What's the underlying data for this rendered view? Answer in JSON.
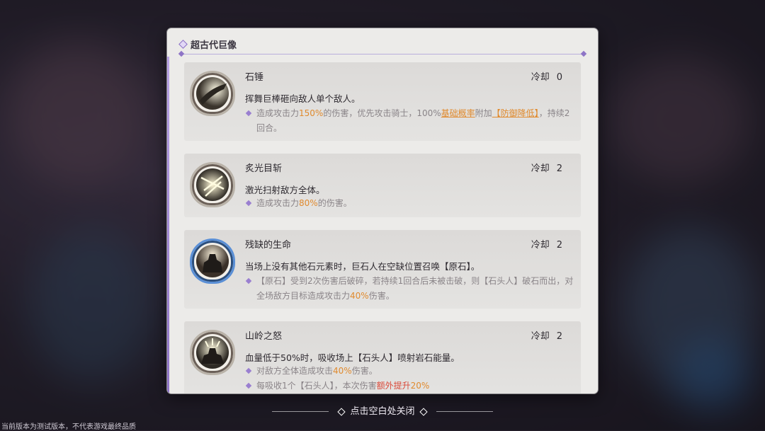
{
  "panel": {
    "title": "超古代巨像"
  },
  "cooldown_label": "冷却",
  "skills": [
    {
      "name": "石锤",
      "cooldown": "0",
      "desc": "挥舞巨棒砸向敌人单个敌人。",
      "effect": {
        "p1": "造成攻击力",
        "v1": "150%",
        "p2": "的伤害，优先攻击骑士，100%",
        "v2": "基础概率",
        "p3": "附加",
        "v3": "【防御降低】",
        "p4": "，持续2回合。"
      }
    },
    {
      "name": "炙光目斩",
      "cooldown": "2",
      "desc": "激光扫射敌方全体。",
      "effect": {
        "p1": "造成攻击力",
        "v1": "80%",
        "p2": "的伤害。"
      }
    },
    {
      "name": "残缺的生命",
      "cooldown": "2",
      "desc": "当场上没有其他石元素时，巨石人在空缺位置召唤【原石】。",
      "effect": {
        "p1": "【原石】受到2次伤害后破碎，若持续1回合后未被击破，则【石头人】破石而出，对全场敌方目标造成攻击力",
        "v1": "40%",
        "p2": "伤害。"
      }
    },
    {
      "name": "山岭之怒",
      "cooldown": "2",
      "desc": "血量低于50%时，吸收场上【石头人】喷射岩石能量。",
      "effect": {
        "p1": "对敌方全体造成攻击",
        "v1": "40%",
        "p2": "伤害。"
      },
      "effect2": {
        "p1": "每吸收1个【石头人】，本次伤害",
        "v1": "额外提升",
        "p2": "20%"
      }
    }
  ],
  "close_hint": "点击空白处关闭",
  "footer_note": "当前版本为测试版本，不代表游戏最终品质"
}
